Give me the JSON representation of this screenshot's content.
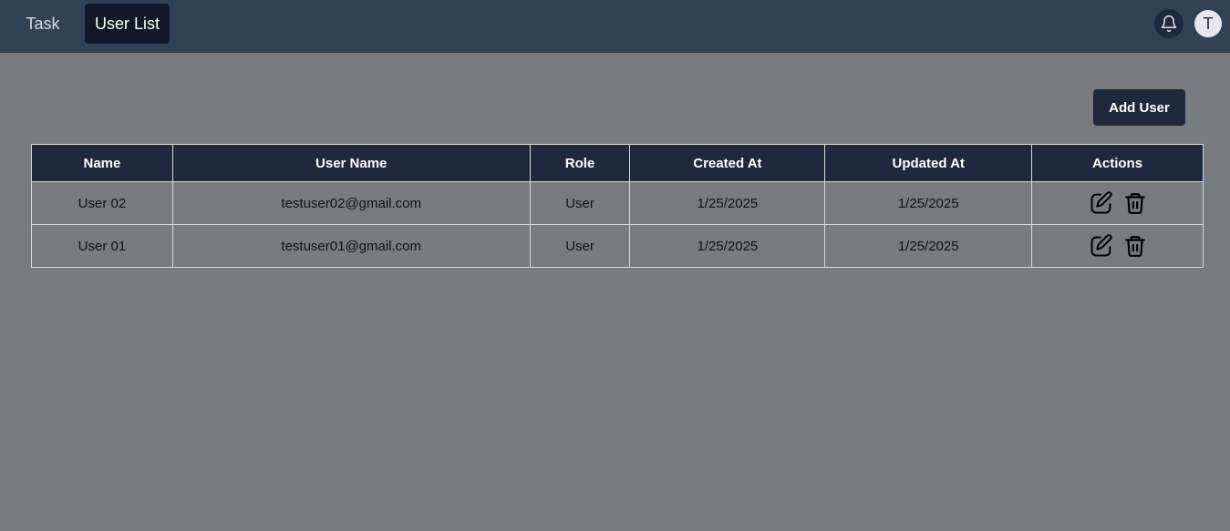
{
  "nav": {
    "tabs": [
      {
        "label": "Task",
        "active": false
      },
      {
        "label": "User List",
        "active": true
      }
    ]
  },
  "header": {
    "notification_icon": "bell-icon",
    "avatar_initial": "T"
  },
  "toolbar": {
    "add_user_label": "Add User"
  },
  "table": {
    "columns": [
      "Name",
      "User Name",
      "Role",
      "Created At",
      "Updated At",
      "Actions"
    ],
    "rows": [
      {
        "name": "User 02",
        "username": "testuser02@gmail.com",
        "role": "User",
        "created_at": "1/25/2025",
        "updated_at": "1/25/2025"
      },
      {
        "name": "User 01",
        "username": "testuser01@gmail.com",
        "role": "User",
        "created_at": "1/25/2025",
        "updated_at": "1/25/2025"
      }
    ],
    "row_actions": [
      "edit-icon",
      "trash-icon"
    ]
  },
  "colors": {
    "topbar": "#334155",
    "active_tab": "#111827",
    "table_header": "#1e293b",
    "page_background": "#787c7f"
  }
}
